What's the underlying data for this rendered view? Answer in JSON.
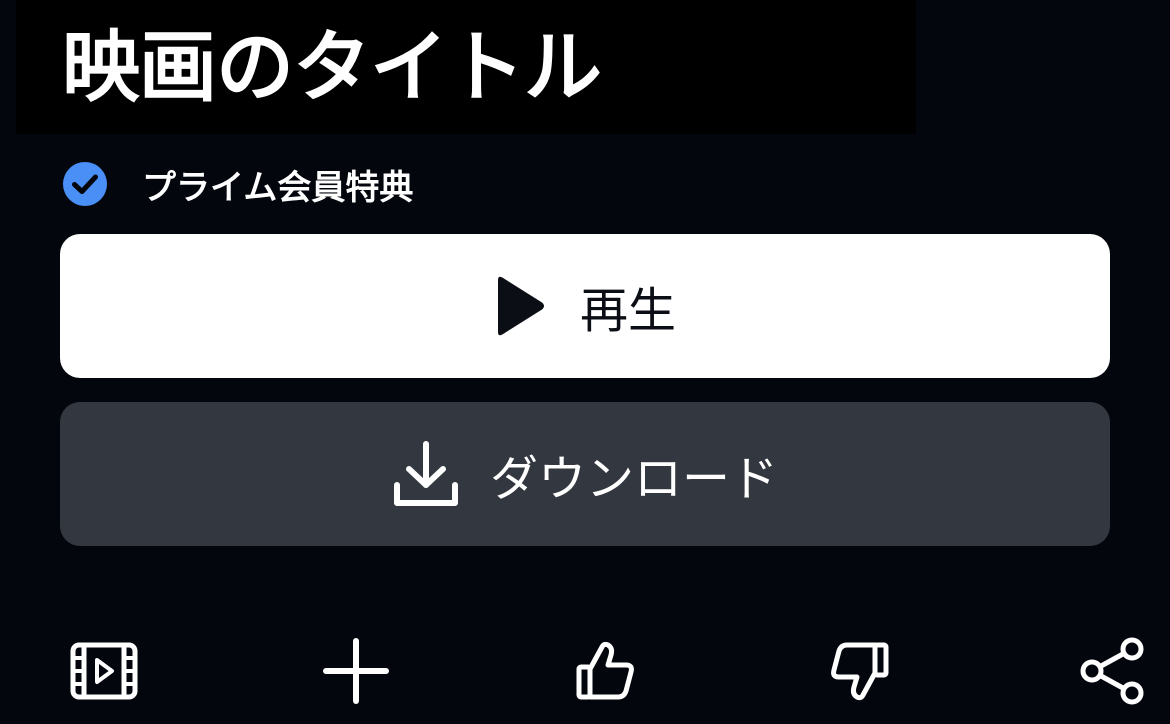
{
  "title": "映画のタイトル",
  "badge": {
    "icon": "check-circle-icon",
    "label": "プライム会員特典",
    "color": "#4a8ff5"
  },
  "buttons": {
    "play": {
      "icon": "play-icon",
      "label": "再生"
    },
    "download": {
      "icon": "download-icon",
      "label": "ダウンロード"
    }
  },
  "actions": [
    {
      "icon": "trailer-film-icon"
    },
    {
      "icon": "plus-icon"
    },
    {
      "icon": "thumbs-up-icon"
    },
    {
      "icon": "thumbs-down-icon"
    },
    {
      "icon": "share-icon"
    }
  ]
}
